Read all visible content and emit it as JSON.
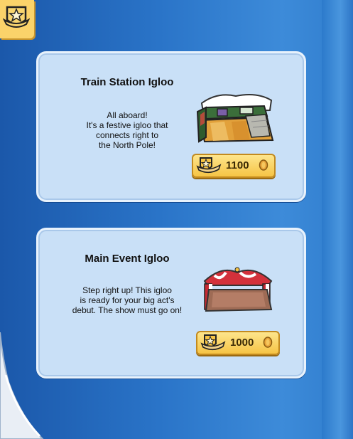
{
  "catalog": {
    "items": [
      {
        "title": "Train Station Igloo",
        "description": "All aboard!\nIt's a festive igloo that\nconnects right to\nthe North Pole!",
        "price": "1100"
      },
      {
        "title": "Main Event Igloo",
        "description": "Step right up! This igloo\nis ready for your big act's\ndebut. The show must go on!",
        "price": "1000"
      }
    ]
  },
  "colors": {
    "page_blue": "#2a74c8",
    "card_bg": "#c9e0f7",
    "button_gold": "#f6c445"
  },
  "icons": [
    "member-badge-icon",
    "coin-icon",
    "star-badge-icon"
  ]
}
